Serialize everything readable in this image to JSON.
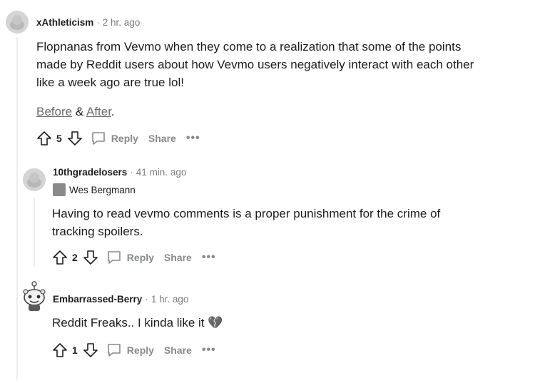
{
  "comments": [
    {
      "username": "xAthleticism",
      "time": "2 hr. ago",
      "body_lines": [
        "Flopnanas from Vevmo when they come to a realization that some of the points",
        "made by Reddit users about how Vevmo users negatively interact with each other",
        "like a week ago are true lol!"
      ],
      "links": {
        "before": "Before",
        "amp": " & ",
        "after": "After",
        "period": "."
      },
      "votes": "5",
      "reply_label": "Reply",
      "share_label": "Share",
      "more_label": "•••"
    },
    {
      "username": "10thgradelosers",
      "time": "41 min. ago",
      "flair": "Wes Bergmann",
      "body_lines": [
        "Having to read vevmo comments is a proper punishment for the crime of",
        "tracking spoilers."
      ],
      "votes": "2",
      "reply_label": "Reply",
      "share_label": "Share",
      "more_label": "•••"
    },
    {
      "username": "Embarrassed-Berry",
      "time": "1 hr. ago",
      "body_lines": [
        "Reddit Freaks.. I kinda like it"
      ],
      "emoji": "💔",
      "votes": "1",
      "reply_label": "Reply",
      "share_label": "Share",
      "more_label": "•••"
    }
  ],
  "separator": "·",
  "colors": {
    "meta": "#7c7c7c",
    "action": "#878a8c",
    "thread_line": "#ededed"
  }
}
